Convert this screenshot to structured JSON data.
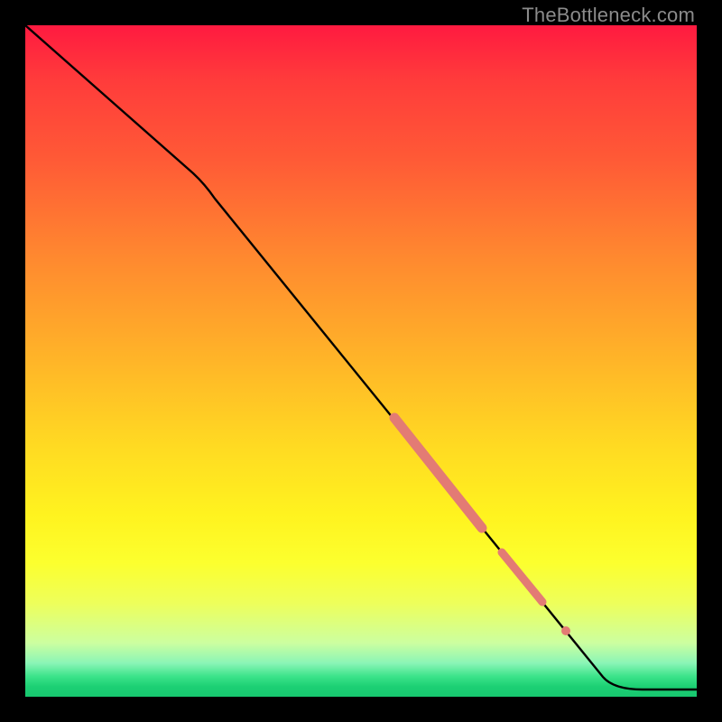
{
  "watermark": {
    "text": "TheBottleneck.com"
  },
  "chart_data": {
    "type": "line",
    "title": "",
    "xlabel": "",
    "ylabel": "",
    "xlim": [
      0,
      100
    ],
    "ylim": [
      0,
      100
    ],
    "grid": false,
    "series": [
      {
        "name": "curve",
        "x": [
          0,
          25,
          86,
          92,
          100
        ],
        "y": [
          100,
          78,
          3,
          1,
          1
        ],
        "stroke": "#000000",
        "stroke_width": 2
      }
    ],
    "highlights": [
      {
        "name": "segment-1",
        "x": [
          55,
          68
        ],
        "y": [
          41.6,
          25.2
        ],
        "stroke": "#e37b74",
        "stroke_width": 9,
        "linecap": "round"
      },
      {
        "name": "segment-2",
        "x": [
          71,
          77
        ],
        "y": [
          21.5,
          14.1
        ],
        "stroke": "#e37b74",
        "stroke_width": 7,
        "linecap": "round"
      },
      {
        "name": "dot-1",
        "x": [
          80.5
        ],
        "y": [
          9.8
        ],
        "stroke": "#e37b74",
        "stroke_width": 6,
        "linecap": "round"
      }
    ],
    "background": {
      "type": "vertical-gradient",
      "stops": [
        {
          "pos": 0.0,
          "color": "#ff1a40"
        },
        {
          "pos": 0.5,
          "color": "#ffdb22"
        },
        {
          "pos": 0.8,
          "color": "#fcff2e"
        },
        {
          "pos": 1.0,
          "color": "#17c76f"
        }
      ]
    }
  }
}
